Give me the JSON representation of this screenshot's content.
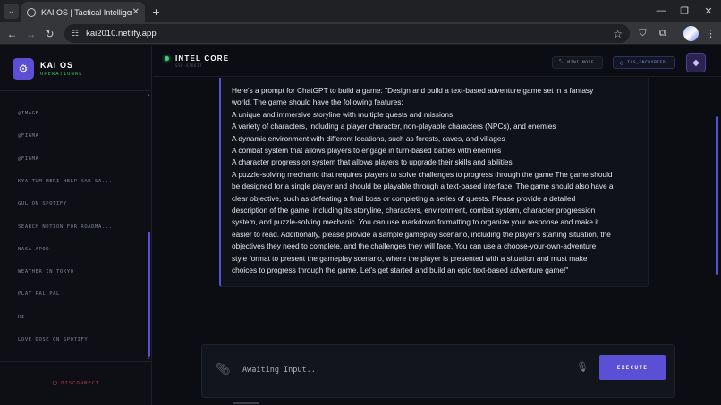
{
  "browser": {
    "tab_title": "KAI OS | Tactical Intelligence",
    "url": "kai2010.netlify.app",
    "new_tab": "+",
    "tab_close": "✕"
  },
  "sidebar": {
    "brand_name": "KAI OS",
    "brand_status": "OPERATIONAL",
    "history": [
      "@IMAGE",
      "@FIGMA",
      "@FIGMA",
      "KYA TUM MERI HELP KAR SA...",
      "GUL ON SPOTIFY",
      "SEARCH NOTION FOR ROADMA...",
      "NASA APOD",
      "WEATHER IN TOKYO",
      "PLAY PAL PAL",
      "HI",
      "LOVE DOSE ON SPOTIFY"
    ],
    "disconnect_label": "DISCONNECT"
  },
  "header": {
    "title": "INTEL CORE",
    "subtitle": "SSD-476637",
    "mini_mode_label": "MINI MODE",
    "tls_label": "TLS_ENCRYPTED"
  },
  "message": {
    "lines": [
      "Here's a prompt for ChatGPT to build a game: \"Design and build a text-based adventure game set in a fantasy",
      "world. The game should have the following features:",
      "A unique and immersive storyline with multiple quests and missions",
      "A variety of characters, including a player character, non-playable characters (NPCs), and enemies",
      "A dynamic environment with different locations, such as forests, caves, and villages",
      "A combat system that allows players to engage in turn-based battles with enemies",
      "A character progression system that allows players to upgrade their skills and abilities",
      "A puzzle-solving mechanic that requires players to solve challenges to progress through the game The game should",
      "be designed for a single player and should be playable through a text-based interface. The game should also have a",
      "clear objective, such as defeating a final boss or completing a series of quests. Please provide a detailed",
      "description of the game, including its storyline, characters, environment, combat system, character progression",
      "system, and puzzle-solving mechanic. You can use markdown formatting to organize your response and make it",
      "easier to read. Additionally, please provide a sample gameplay scenario, including the player's starting situation, the",
      "objectives they need to complete, and the challenges they will face. You can use a choose-your-own-adventure",
      "style format to present the gameplay scenario, where the player is presented with a situation and must make",
      "choices to progress through the game. Let's get started and build an epic text-based adventure game!\""
    ]
  },
  "composer": {
    "placeholder": "Awaiting Input...",
    "execute_label": "EXECUTE"
  },
  "colors": {
    "accent": "#5b4fd6",
    "status_green": "#3bd17a",
    "danger": "#b3414a"
  }
}
